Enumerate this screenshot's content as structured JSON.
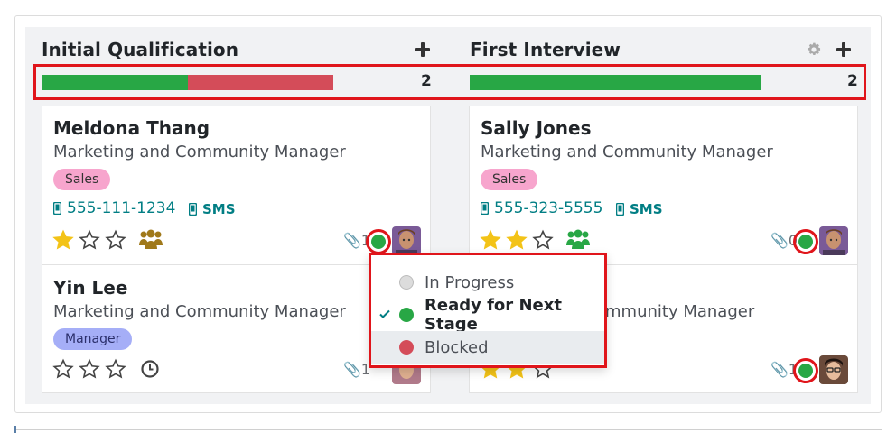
{
  "columns": [
    {
      "title": "Initial Qualification",
      "count": "2",
      "progress": {
        "green": 0.5,
        "red": 0.5
      },
      "cards": [
        {
          "name": "Meldona Thang",
          "job": "Marketing and Community Manager",
          "tag": "Sales",
          "phone": "555-111-1234",
          "sms": "SMS",
          "stars": 1,
          "activity_icon": "people-icon",
          "attachments": "1",
          "status": "ready"
        },
        {
          "name": "Yin Lee",
          "job": "Marketing and Community Manager",
          "tag": "Manager",
          "stars": 0,
          "activity_icon": "clock-icon",
          "attachments": "1"
        }
      ]
    },
    {
      "title": "First Interview",
      "count": "2",
      "progress": {
        "green": 1.0,
        "red": 0.0
      },
      "cards": [
        {
          "name": "Sally Jones",
          "job": "Marketing and Community Manager",
          "tag": "Sales",
          "phone": "555-323-5555",
          "sms": "SMS",
          "stars": 2,
          "activity_icon": "people-icon",
          "attachments": "0",
          "status": "ready"
        },
        {
          "job_partial": "mmunity Manager",
          "stars": 2,
          "attachments": "1",
          "status": "ready"
        }
      ]
    }
  ],
  "status_menu": {
    "items": [
      {
        "label": "In Progress",
        "color": "#dcdcdc"
      },
      {
        "label": "Ready for Next Stage",
        "color": "#28a745",
        "selected": true
      },
      {
        "label": "Blocked",
        "color": "#d44c59"
      }
    ]
  },
  "colors": {
    "accent_teal": "#017e84",
    "ready_green": "#28a745",
    "blocked_red": "#d44c59",
    "star_gold": "#f3c317",
    "highlight_red": "#e0151b"
  }
}
